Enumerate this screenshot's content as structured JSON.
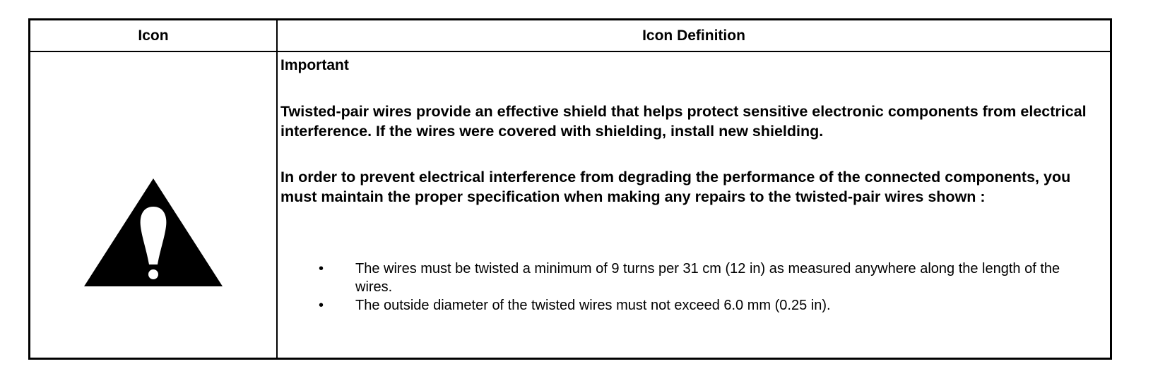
{
  "table": {
    "header": {
      "icon_col": "Icon",
      "definition_col": "Icon Definition"
    },
    "icon": "warning-triangle-icon",
    "definition": {
      "label": "Important",
      "paragraph1": "Twisted-pair wires provide an effective shield that helps protect sensitive electronic components from electrical interference. If the wires were covered with shielding, install new shielding.",
      "paragraph2": "In order to prevent electrical interference from degrading the performance of the connected components, you must maintain the proper specification when making any repairs to the twisted-pair wires shown :",
      "bullets": [
        "The wires must be twisted a minimum of 9 turns per 31 cm (12 in) as measured anywhere along the length of the wires.",
        "The outside diameter of the twisted wires must not exceed 6.0 mm (0.25 in)."
      ]
    }
  }
}
